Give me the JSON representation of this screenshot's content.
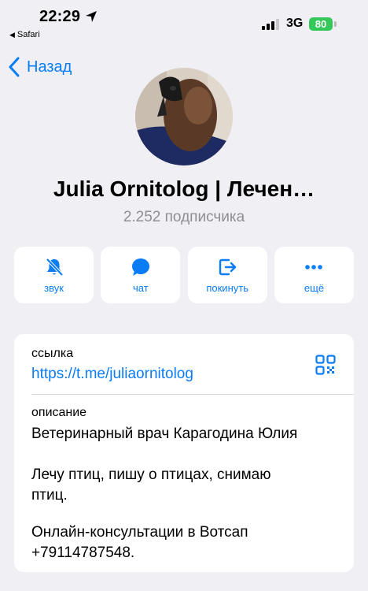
{
  "status_bar": {
    "time": "22:29",
    "back_app": "Safari",
    "network": "3G",
    "battery": "80"
  },
  "nav": {
    "back_label": "Назад"
  },
  "channel": {
    "title": "Julia Ornitolog | Лечен…",
    "subscribers": "2.252 подписчика"
  },
  "actions": [
    {
      "label": "звук",
      "icon": "bell-slash-icon"
    },
    {
      "label": "чат",
      "icon": "chat-bubble-icon"
    },
    {
      "label": "покинуть",
      "icon": "leave-icon"
    },
    {
      "label": "ещё",
      "icon": "more-dots-icon"
    }
  ],
  "info": {
    "link_label": "ссылка",
    "link_value": "https://t.me/juliaornitolog",
    "description_label": "описание",
    "description_lines": [
      "Ветеринарный врач Карагодина Юлия",
      "Лечу птиц, пишу о птицах, снимаю",
      "птиц.",
      "Онлайн-консультации в Вотсап",
      "+79114787548."
    ]
  },
  "colors": {
    "accent": "#0a7cf5",
    "background": "#efeff4",
    "battery": "#34c759",
    "secondary_text": "#8e8e93"
  }
}
